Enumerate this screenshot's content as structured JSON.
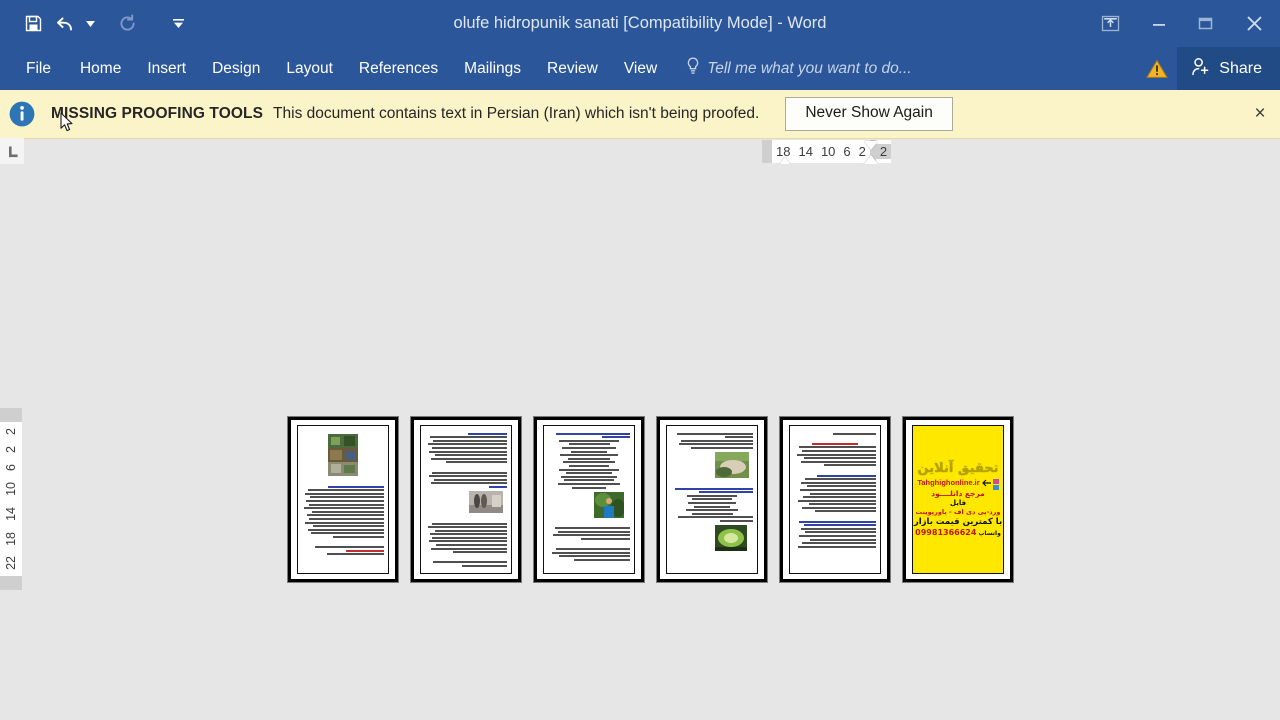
{
  "window": {
    "title": "olufe hidropunik sanati [Compatibility Mode] - Word",
    "quick_access": [
      {
        "name": "save-icon",
        "label": "Save"
      },
      {
        "name": "undo-icon",
        "label": "Undo"
      },
      {
        "name": "undo-dropdown-icon",
        "label": "Undo options"
      },
      {
        "name": "redo-icon",
        "label": "Repeat"
      },
      {
        "name": "customize-qat-icon",
        "label": "Customize Quick Access Toolbar"
      }
    ],
    "controls": [
      {
        "name": "ribbon-display-options-icon",
        "label": "Ribbon Display Options"
      },
      {
        "name": "minimize-icon",
        "label": "Minimize"
      },
      {
        "name": "restore-icon",
        "label": "Restore Down"
      },
      {
        "name": "close-icon",
        "label": "Close"
      }
    ],
    "accent_color": "#2b579a",
    "share_bg_color": "#204b84"
  },
  "ribbon": {
    "tabs": [
      {
        "label": "File"
      },
      {
        "label": "Home"
      },
      {
        "label": "Insert"
      },
      {
        "label": "Design"
      },
      {
        "label": "Layout"
      },
      {
        "label": "References"
      },
      {
        "label": "Mailings"
      },
      {
        "label": "Review"
      },
      {
        "label": "View"
      }
    ],
    "tell_me": {
      "placeholder": "Tell me what you want to do...",
      "icon": "lightbulb-icon"
    },
    "warning": {
      "name": "warning-icon",
      "color": "#f0b429"
    },
    "share": {
      "label": "Share",
      "icon": "person-add-icon"
    }
  },
  "message_bar": {
    "icon": "info-icon",
    "title": "MISSING PROOFING TOOLS",
    "text": "This document contains text in Persian (Iran) which isn't being proofed.",
    "button_label": "Never Show Again",
    "close_label": "×",
    "background_color": "#fbf4c8"
  },
  "rulers": {
    "tab_selector": {
      "name": "tab-stop-selector",
      "glyph": "L"
    },
    "horizontal_ticks": [
      "18",
      "14",
      "10",
      "6",
      "2",
      "2"
    ],
    "vertical_ticks": [
      "2",
      "2",
      "6",
      "10",
      "14",
      "18",
      "22"
    ],
    "indent_markers": [
      "first-line-indent-marker",
      "hanging-indent-marker",
      "left-indent-marker"
    ]
  },
  "document": {
    "zoom_view": "multiple-pages",
    "page_count": 6,
    "pages": [
      {
        "number": 1,
        "has_image": true,
        "image_kind": "color-photo-collage",
        "accent_text": "red"
      },
      {
        "number": 2,
        "has_image": true,
        "image_kind": "grayscale-photo",
        "accent_text": "blue"
      },
      {
        "number": 3,
        "has_image": true,
        "image_kind": "color-photo-person",
        "accent_text": "blue"
      },
      {
        "number": 4,
        "has_image": true,
        "image_kind": "color-photo-plants",
        "accent_text": "blue"
      },
      {
        "number": 5,
        "has_image": false,
        "image_kind": "none",
        "accent_text": "red-and-blue"
      },
      {
        "number": 6,
        "has_image": false,
        "image_kind": "advertisement",
        "accent_text": "yellow-ad"
      }
    ],
    "ad_page": {
      "logo": "تحقیق آنلاین",
      "url": "Tahghighonline.ir",
      "line1": "مرجع دانلــــود",
      "line2": "فایل",
      "line3": "ورد-پی دی اف - پاورپوینت",
      "line4": "با کمترین قیمت بازار",
      "phone": "09981366624",
      "whatsapp": "واتساپ",
      "background_color": "#ffe800"
    }
  }
}
